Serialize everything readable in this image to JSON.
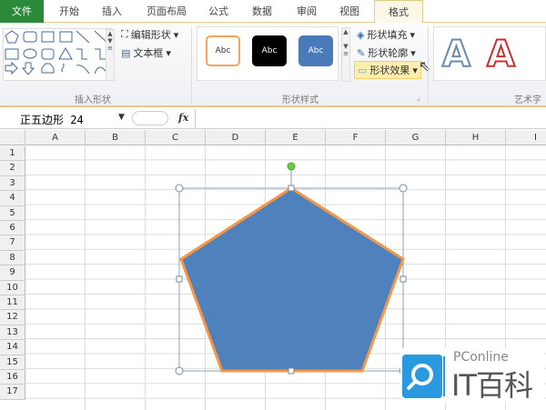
{
  "tabs": [
    "文件",
    "开始",
    "插入",
    "页面布局",
    "公式",
    "数据",
    "审阅",
    "视图",
    "格式"
  ],
  "ribbon": {
    "insert_shapes": {
      "label": "插入形状",
      "edit_shape": "编辑形状",
      "text_box": "文本框"
    },
    "shape_styles": {
      "label": "形状样式",
      "presets": [
        "Abc",
        "Abc",
        "Abc"
      ],
      "fill": "形状填充",
      "outline": "形状轮廓",
      "effects": "形状效果"
    },
    "wordart": {
      "label": "艺术字",
      "samples": [
        "A",
        "A"
      ]
    }
  },
  "formula_bar": {
    "name_box": "正五边形 24",
    "fx": "fx",
    "value": ""
  },
  "columns": [
    "A",
    "B",
    "C",
    "D",
    "E",
    "F",
    "G",
    "H",
    "I"
  ],
  "rows": [
    "1",
    "2",
    "3",
    "4",
    "5",
    "6",
    "7",
    "8",
    "9",
    "10",
    "11",
    "12",
    "13",
    "14",
    "15",
    "16",
    "17"
  ],
  "shape": {
    "type": "pentagon",
    "fill": "#4f81bd",
    "outline": "#f79646"
  },
  "watermark": {
    "brand": "PConline",
    "name": "IT百科"
  }
}
